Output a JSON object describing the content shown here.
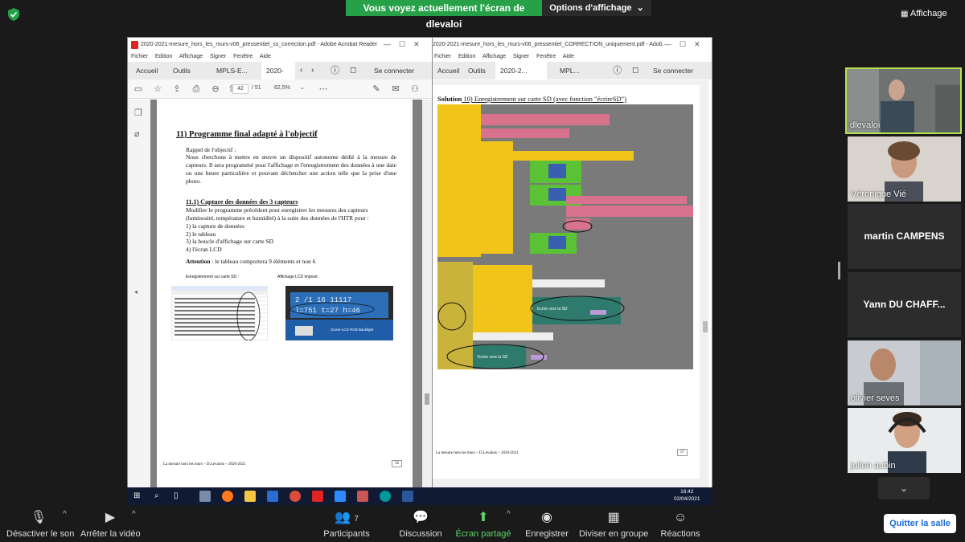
{
  "top": {
    "share_banner": "Vous voyez actuellement l'écran de dlevaloi",
    "view_options": "Options d'affichage",
    "layout": "Affichage"
  },
  "acrobat_left": {
    "title": "2020-2021-mesure_hors_les_murs-v06_pressentiel_ss_correction.pdf - Adobe Acrobat Reader ...",
    "menu": [
      "Fichier",
      "Edition",
      "Affichage",
      "Signer",
      "Fenêtre",
      "Aide"
    ],
    "tabs": [
      "Accueil",
      "Outils",
      "MPLS-E...",
      "2020-2..."
    ],
    "connect": "Se connecter",
    "page_current": "42",
    "page_total": "/ 51",
    "zoom": "62,5%",
    "page_heading": "11) Programme final adapté à l'objectif",
    "reminder_title": "Rappel de l'objectif :",
    "reminder_text": "Nous cherchons à mettre en œuvre un dispositif autonome dédié à la mesure de capteurs. Il sera programmé pour l'affichage et l'enregistrement des données à une date ou une heure particulière et pouvant déclencher une action telle que la prise d'une photo.",
    "section_heading": "11.1)   Capture des données des 3 capteurs",
    "section_intro": "Modifier le programme précédent pour enregistrer les mesures des capteurs (luminosité, température et humidité) à la suite des données de l'HTR pour :",
    "list": [
      "1) la capture de données",
      "2) le tableau",
      "3) la boucle d'affichage sur carte SD",
      "4) l'écran LCD"
    ],
    "attention_label": "Attention",
    "attention_text": " : le tableau comportera 9 éléments et non 6",
    "caption_sd": "Enregistrement sur carte SD :",
    "caption_lcd": "Affichage LCD imposé :",
    "lcd_line1": "2 /1   16 11117",
    "lcd_line2": "l=751 t=27 h=46",
    "lcd_board": "Grove-LCD RGB Backlight",
    "footer": "La mesure hors les murs – D.Levalois – 2020-2021",
    "page_number": "56"
  },
  "acrobat_right": {
    "title": "2020-2021-mesure_hors_les_murs-v06_pressentiel_CORRECTION_uniquement.pdf - Adob...",
    "menu": [
      "Fichier",
      "Edition",
      "Affichage",
      "Signer",
      "Fenêtre",
      "Aide"
    ],
    "tabs": [
      "Accueil",
      "Outils",
      "2020-2...",
      "MPL..."
    ],
    "connect": "Se connecter",
    "solution_label": "Solution",
    "solution_text": " 10) Enregistrement sur carte SD (avec fonction \"écrireSD\")",
    "block_label_1": "Ecrire vers la SD",
    "block_label_2": "Ecrire vers la SD",
    "footer": "La mesure hors les murs – D.Levalois – 2020-2021",
    "page_number": "57"
  },
  "taskbar": {
    "time": "16:42",
    "date": "02/04/2021"
  },
  "participants_panel": [
    {
      "name": "dlevaloi",
      "type": "video"
    },
    {
      "name": "Véronique Vié",
      "type": "video"
    },
    {
      "name": "martin CAMPENS",
      "type": "name"
    },
    {
      "name": "Yann DU CHAFF...",
      "type": "name"
    },
    {
      "name": "olivier seves",
      "type": "video"
    },
    {
      "name": "julien aubin",
      "type": "video"
    }
  ],
  "bottom": {
    "mute": "Désactiver le son",
    "video": "Arrêter la vidéo",
    "participants": "Participants",
    "participants_count": "7",
    "chat": "Discussion",
    "share": "Écran partagé",
    "record": "Enregistrer",
    "breakout": "Diviser en groupe",
    "reactions": "Réactions",
    "leave": "Quitter la salle"
  },
  "colors": {
    "share_green": "#26a148",
    "active_speaker": "#b8e34c",
    "scratch_yellow": "#f0c419",
    "scratch_green": "#5bc236",
    "scratch_pink": "#d9738d",
    "scratch_teal": "#2e7a6c"
  }
}
